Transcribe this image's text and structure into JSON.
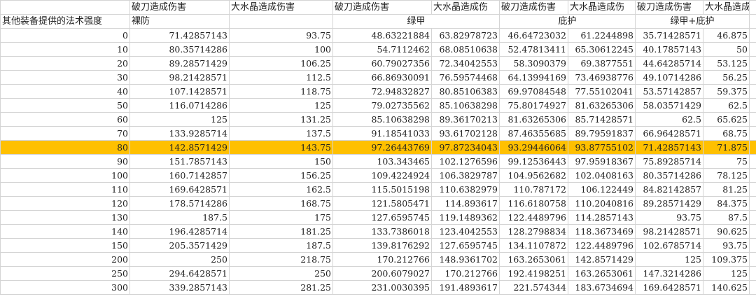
{
  "header_row1": [
    "",
    "破刀造成伤害",
    "大水晶造成伤害",
    "破刀造成伤害",
    "大水晶造成伤",
    "破刀造成伤害",
    "大水晶造成伤",
    "破刀造成伤害",
    "大水晶造成伤"
  ],
  "header_row2": {
    "row_label": "其他装备提供的法术强度",
    "group_bare": "裸防",
    "group_green": "绿甲",
    "group_shelter": "庇护",
    "group_combo": "绿甲+庇护"
  },
  "highlight_color": "#ffc000",
  "highlight_row_index": 8,
  "rows": [
    [
      "0",
      "71.42857143",
      "93.75",
      "48.63221884",
      "63.82978723",
      "46.64723032",
      "61.2244898",
      "35.71428571",
      "46.875"
    ],
    [
      "10",
      "80.35714286",
      "100",
      "54.7112462",
      "68.08510638",
      "52.47813411",
      "65.30612245",
      "40.17857143",
      "50"
    ],
    [
      "20",
      "89.28571429",
      "106.25",
      "60.79027356",
      "72.34042553",
      "58.3090379",
      "69.3877551",
      "44.64285714",
      "53.125"
    ],
    [
      "30",
      "98.21428571",
      "112.5",
      "66.86930091",
      "76.59574468",
      "64.13994169",
      "73.46938776",
      "49.10714286",
      "56.25"
    ],
    [
      "40",
      "107.1428571",
      "118.75",
      "72.94832827",
      "80.85106383",
      "69.97084548",
      "77.55102041",
      "53.57142857",
      "59.375"
    ],
    [
      "50",
      "116.0714286",
      "125",
      "79.02735562",
      "85.10638298",
      "75.80174927",
      "81.63265306",
      "58.03571429",
      "62.5"
    ],
    [
      "60",
      "125",
      "131.25",
      "85.10638298",
      "89.36170213",
      "81.63265306",
      "85.71428571",
      "62.5",
      "65.625"
    ],
    [
      "70",
      "133.9285714",
      "137.5",
      "91.18541033",
      "93.61702128",
      "87.46355685",
      "89.79591837",
      "66.96428571",
      "68.75"
    ],
    [
      "80",
      "142.8571429",
      "143.75",
      "97.26443769",
      "97.87234043",
      "93.29446064",
      "93.87755102",
      "71.42857143",
      "71.875"
    ],
    [
      "90",
      "151.7857143",
      "150",
      "103.343465",
      "102.1276596",
      "99.12536443",
      "97.95918367",
      "75.89285714",
      "75"
    ],
    [
      "100",
      "160.7142857",
      "156.25",
      "109.4224924",
      "106.3829787",
      "104.9562682",
      "102.0408163",
      "80.35714286",
      "78.125"
    ],
    [
      "110",
      "169.6428571",
      "162.5",
      "115.5015198",
      "110.6382979",
      "110.787172",
      "106.122449",
      "84.82142857",
      "81.25"
    ],
    [
      "120",
      "178.5714286",
      "168.75",
      "121.5805471",
      "114.893617",
      "116.6180758",
      "110.2040816",
      "89.28571429",
      "84.375"
    ],
    [
      "130",
      "187.5",
      "175",
      "127.6595745",
      "119.1489362",
      "122.4489796",
      "114.2857143",
      "93.75",
      "87.5"
    ],
    [
      "140",
      "196.4285714",
      "181.25",
      "133.7386018",
      "123.4042553",
      "128.2798834",
      "118.3673469",
      "98.21428571",
      "90.625"
    ],
    [
      "150",
      "205.3571429",
      "187.5",
      "139.8176292",
      "127.6595745",
      "134.1107872",
      "122.4489796",
      "102.6785714",
      "93.75"
    ],
    [
      "200",
      "250",
      "218.75",
      "170.212766",
      "148.9361702",
      "163.2653061",
      "142.8571429",
      "125",
      "109.375"
    ],
    [
      "250",
      "294.6428571",
      "250",
      "200.6079027",
      "170.212766",
      "192.4198251",
      "163.2653061",
      "147.3214286",
      "125"
    ],
    [
      "300",
      "339.2857143",
      "281.25",
      "231.0030395",
      "191.4893617",
      "221.574344",
      "183.6734694",
      "169.6428571",
      "140.625"
    ]
  ]
}
